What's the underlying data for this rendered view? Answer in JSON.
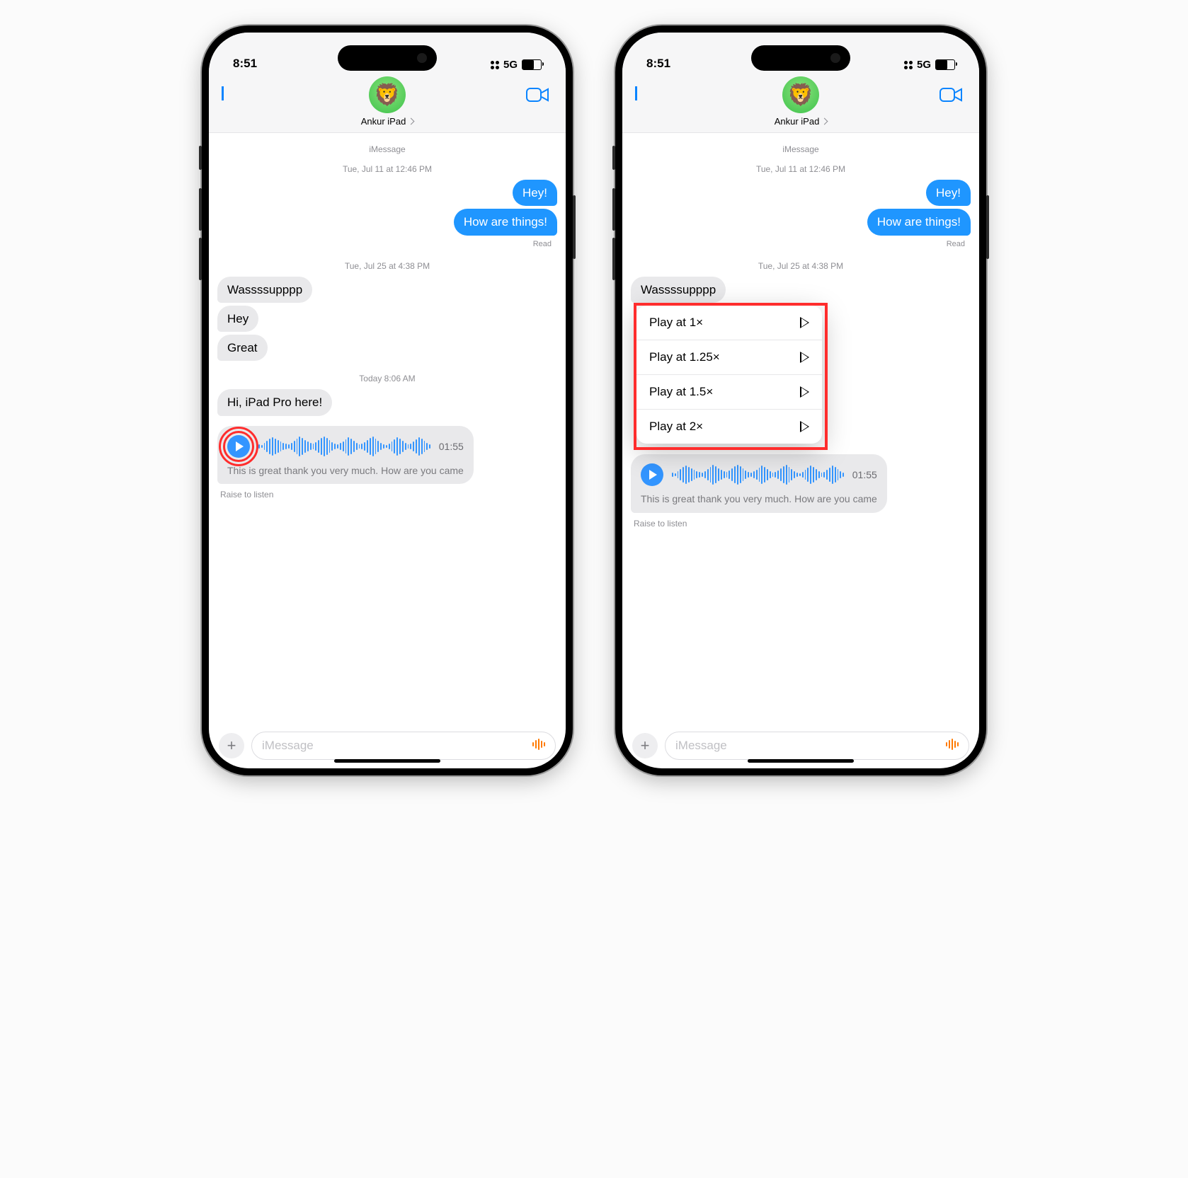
{
  "status": {
    "time": "8:51",
    "network": "5G"
  },
  "header": {
    "contact_name": "Ankur iPad",
    "avatar_emoji": "🦁"
  },
  "thread": {
    "service_label": "iMessage",
    "ts1": "Tue, Jul 11 at 12:46 PM",
    "sent1": "Hey!",
    "sent2": "How are things!",
    "read_label": "Read",
    "ts2": "Tue, Jul 25 at 4:38 PM",
    "recv1": "Wassssupppp",
    "recv2": "Hey",
    "recv3": "Great",
    "ts3": "Today 8:06 AM",
    "recv4": "Hi, iPad Pro here!",
    "audio": {
      "duration": "01:55",
      "transcript": "This is great thank you very much. How are you came"
    },
    "raise_hint": "Raise to listen"
  },
  "context_menu": {
    "items": [
      {
        "label": "Play at 1×"
      },
      {
        "label": "Play at 1.25×"
      },
      {
        "label": "Play at 1.5×"
      },
      {
        "label": "Play at 2×"
      }
    ]
  },
  "compose": {
    "placeholder": "iMessage"
  }
}
